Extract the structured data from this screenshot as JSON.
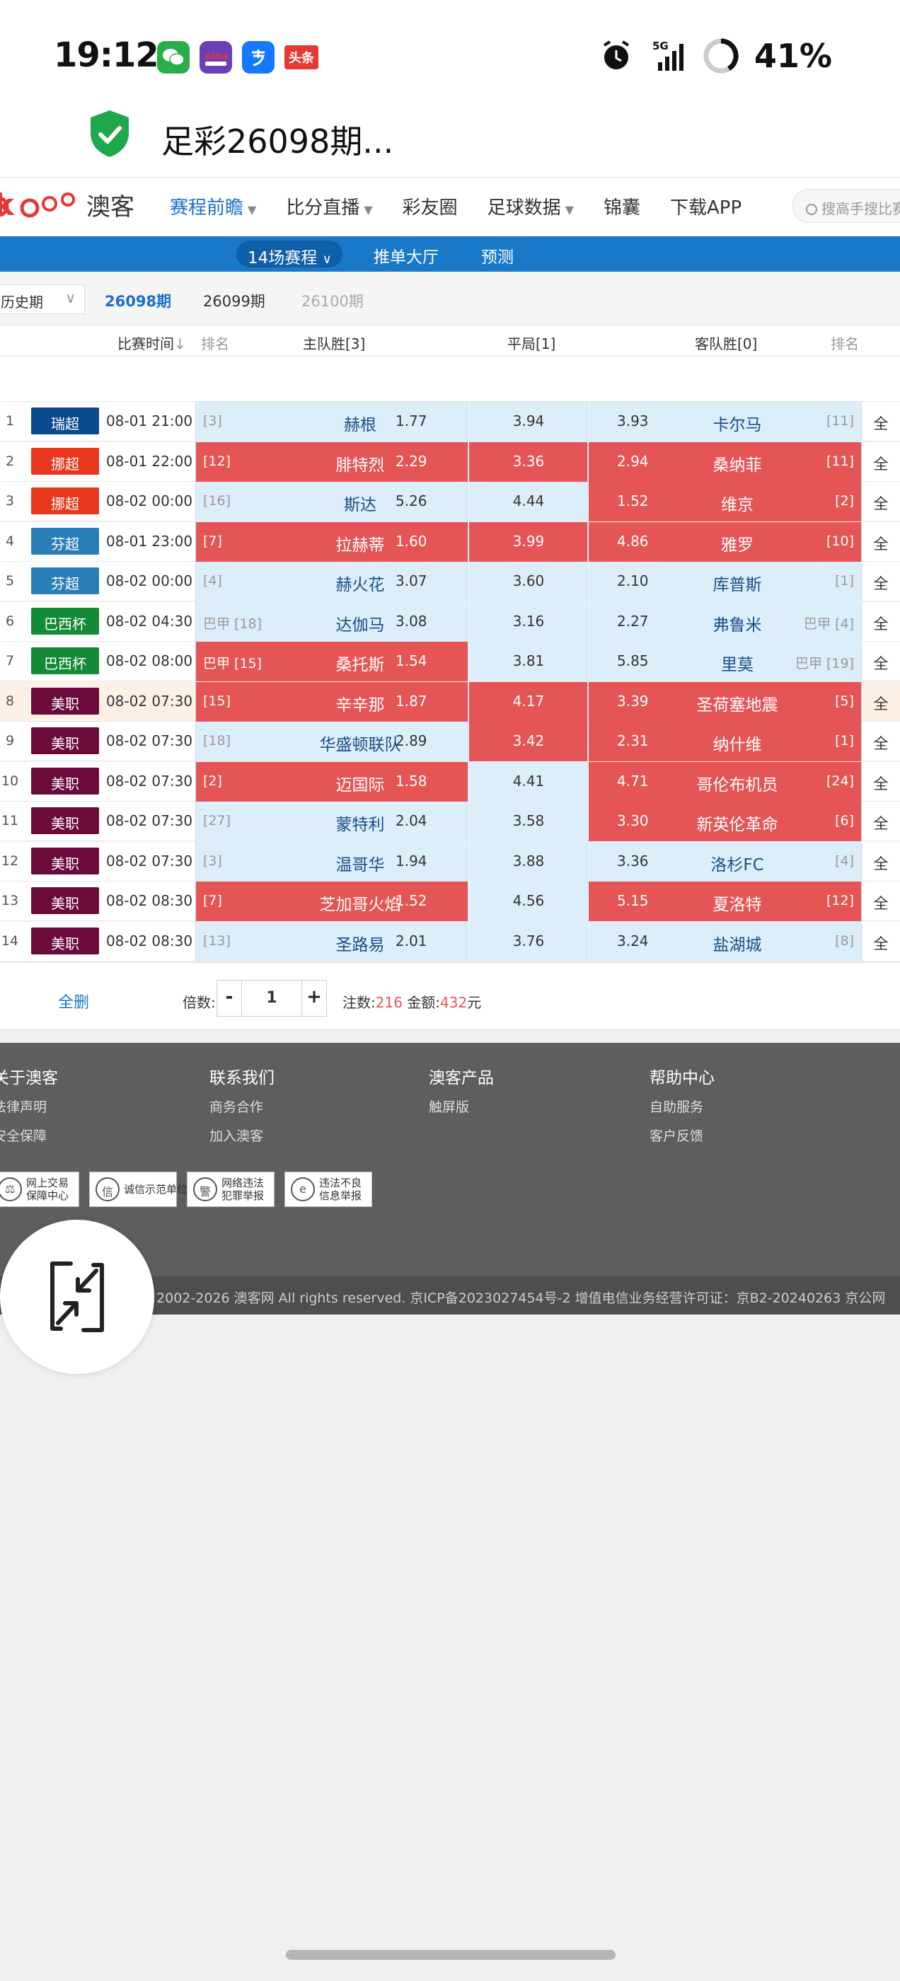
{
  "status_bar": {
    "time": "19:12",
    "battery": "41%",
    "network": "5G",
    "apps": [
      "wechat-icon",
      "sina-icon",
      "alipay-icon",
      "toutiao-icon"
    ],
    "toutiao_label": "头条"
  },
  "page": {
    "title": "足彩26098期..."
  },
  "nav": {
    "logo_text": "okooo",
    "logo_cn": "澳客",
    "items": [
      {
        "label": "赛程前瞻",
        "active": true,
        "caret": true
      },
      {
        "label": "比分直播",
        "active": false,
        "caret": true
      },
      {
        "label": "彩友圈",
        "active": false,
        "caret": false
      },
      {
        "label": "足球数据",
        "active": false,
        "caret": true
      },
      {
        "label": "锦囊",
        "active": false,
        "caret": false
      },
      {
        "label": "下载APP",
        "active": false,
        "caret": false
      }
    ],
    "search_placeholder": "搜高手搜比赛"
  },
  "subnav": {
    "selected": "14场赛程",
    "items": [
      "推单大厅",
      "预测"
    ]
  },
  "periods": {
    "history": "历史期",
    "current": "26098期",
    "next": "26099期",
    "future": "26100期"
  },
  "table": {
    "headers": {
      "time": "比赛时间",
      "home_rank": "排名",
      "home": "主队胜[3]",
      "draw": "平局[1]",
      "away": "客队胜[0]",
      "away_rank": "排名"
    },
    "all_label": "全",
    "rows": [
      {
        "no": "1",
        "league": "瑞超",
        "league_color": "#0b4a8f",
        "time": "08-01 21:00",
        "home_rank": "[3]",
        "home": "赫根",
        "home_odd": "1.77",
        "draw_odd": "3.94",
        "away_odd": "3.93",
        "away": "卡尔马",
        "away_rank": "[11]",
        "home_sel": false,
        "draw_sel": false,
        "away_sel": false,
        "hl": false
      },
      {
        "no": "2",
        "league": "挪超",
        "league_color": "#e8371d",
        "time": "08-01 22:00",
        "home_rank": "[12]",
        "home": "腓特烈",
        "home_odd": "2.29",
        "draw_odd": "3.36",
        "away_odd": "2.94",
        "away": "桑纳菲",
        "away_rank": "[11]",
        "home_sel": true,
        "draw_sel": true,
        "away_sel": true,
        "hl": false
      },
      {
        "no": "3",
        "league": "挪超",
        "league_color": "#e8371d",
        "time": "08-02 00:00",
        "home_rank": "[16]",
        "home": "斯达",
        "home_odd": "5.26",
        "draw_odd": "4.44",
        "away_odd": "1.52",
        "away": "维京",
        "away_rank": "[2]",
        "home_sel": false,
        "draw_sel": false,
        "away_sel": true,
        "hl": false
      },
      {
        "no": "4",
        "league": "芬超",
        "league_color": "#2a7fb8",
        "time": "08-01 23:00",
        "home_rank": "[7]",
        "home": "拉赫蒂",
        "home_odd": "1.60",
        "draw_odd": "3.99",
        "away_odd": "4.86",
        "away": "雅罗",
        "away_rank": "[10]",
        "home_sel": true,
        "draw_sel": true,
        "away_sel": true,
        "hl": false
      },
      {
        "no": "5",
        "league": "芬超",
        "league_color": "#2a7fb8",
        "time": "08-02 00:00",
        "home_rank": "[4]",
        "home": "赫火花",
        "home_odd": "3.07",
        "draw_odd": "3.60",
        "away_odd": "2.10",
        "away": "库普斯",
        "away_rank": "[1]",
        "home_sel": false,
        "draw_sel": false,
        "away_sel": false,
        "hl": false
      },
      {
        "no": "6",
        "league": "巴西杯",
        "league_color": "#138a36",
        "time": "08-02 04:30",
        "home_rank": "巴甲 [18]",
        "home": "达伽马",
        "home_odd": "3.08",
        "draw_odd": "3.16",
        "away_odd": "2.27",
        "away": "弗鲁米",
        "away_rank": "巴甲 [4]",
        "home_sel": false,
        "draw_sel": false,
        "away_sel": false,
        "hl": false
      },
      {
        "no": "7",
        "league": "巴西杯",
        "league_color": "#138a36",
        "time": "08-02 08:00",
        "home_rank": "巴甲 [15]",
        "home": "桑托斯",
        "home_odd": "1.54",
        "draw_odd": "3.81",
        "away_odd": "5.85",
        "away": "里莫",
        "away_rank": "巴甲 [19]",
        "home_sel": true,
        "draw_sel": false,
        "away_sel": false,
        "hl": false
      },
      {
        "no": "8",
        "league": "美职",
        "league_color": "#6b0a3a",
        "time": "08-02 07:30",
        "home_rank": "[15]",
        "home": "辛辛那",
        "home_odd": "1.87",
        "draw_odd": "4.17",
        "away_odd": "3.39",
        "away": "圣荷塞地震",
        "away_rank": "[5]",
        "home_sel": true,
        "draw_sel": true,
        "away_sel": true,
        "hl": true
      },
      {
        "no": "9",
        "league": "美职",
        "league_color": "#6b0a3a",
        "time": "08-02 07:30",
        "home_rank": "[18]",
        "home": "华盛顿联队",
        "home_odd": "2.89",
        "draw_odd": "3.42",
        "away_odd": "2.31",
        "away": "纳什维",
        "away_rank": "[1]",
        "home_sel": false,
        "draw_sel": true,
        "away_sel": true,
        "hl": false
      },
      {
        "no": "10",
        "league": "美职",
        "league_color": "#6b0a3a",
        "time": "08-02 07:30",
        "home_rank": "[2]",
        "home": "迈国际",
        "home_odd": "1.58",
        "draw_odd": "4.41",
        "away_odd": "4.71",
        "away": "哥伦布机员",
        "away_rank": "[24]",
        "home_sel": true,
        "draw_sel": false,
        "away_sel": true,
        "hl": false
      },
      {
        "no": "11",
        "league": "美职",
        "league_color": "#6b0a3a",
        "time": "08-02 07:30",
        "home_rank": "[27]",
        "home": "蒙特利",
        "home_odd": "2.04",
        "draw_odd": "3.58",
        "away_odd": "3.30",
        "away": "新英伦革命",
        "away_rank": "[6]",
        "home_sel": false,
        "draw_sel": false,
        "away_sel": true,
        "hl": false
      },
      {
        "no": "12",
        "league": "美职",
        "league_color": "#6b0a3a",
        "time": "08-02 07:30",
        "home_rank": "[3]",
        "home": "温哥华",
        "home_odd": "1.94",
        "draw_odd": "3.88",
        "away_odd": "3.36",
        "away": "洛杉FC",
        "away_rank": "[4]",
        "home_sel": false,
        "draw_sel": false,
        "away_sel": false,
        "hl": false
      },
      {
        "no": "13",
        "league": "美职",
        "league_color": "#6b0a3a",
        "time": "08-02 08:30",
        "home_rank": "[7]",
        "home": "芝加哥火焰",
        "home_odd": "1.52",
        "draw_odd": "4.56",
        "away_odd": "5.15",
        "away": "夏洛特",
        "away_rank": "[12]",
        "home_sel": true,
        "draw_sel": false,
        "away_sel": true,
        "hl": false
      },
      {
        "no": "14",
        "league": "美职",
        "league_color": "#6b0a3a",
        "time": "08-02 08:30",
        "home_rank": "[13]",
        "home": "圣路易",
        "home_odd": "2.01",
        "draw_odd": "3.76",
        "away_odd": "3.24",
        "away": "盐湖城",
        "away_rank": "[8]",
        "home_sel": false,
        "draw_sel": false,
        "away_sel": false,
        "hl": false
      }
    ]
  },
  "controls": {
    "clear_label": "全删",
    "multiplier_label": "倍数:",
    "minus": "-",
    "plus": "+",
    "multiplier": "1",
    "bets_label": "注数:",
    "bets": "216",
    "amount_label": "金额:",
    "amount": "432",
    "unit": "元"
  },
  "footer": {
    "columns": [
      {
        "title": "关于澳客",
        "links": [
          "法律声明",
          "安全保障"
        ]
      },
      {
        "title": "联系我们",
        "links": [
          "商务合作",
          "加入澳客"
        ]
      },
      {
        "title": "澳客产品",
        "links": [
          "触屏版"
        ]
      },
      {
        "title": "帮助中心",
        "links": [
          "自助服务",
          "客户反馈"
        ]
      }
    ],
    "badges": [
      {
        "icon": "scale-icon",
        "glyph": "⚖",
        "text": [
          "网上交易",
          "保障中心"
        ]
      },
      {
        "icon": "integrity-icon",
        "glyph": "信",
        "text": [
          "诚信示范单位"
        ]
      },
      {
        "icon": "police-icon",
        "glyph": "警",
        "text": [
          "网络违法",
          "犯罪举报"
        ]
      },
      {
        "icon": "report-icon",
        "glyph": "e",
        "text": [
          "违法不良",
          "信息举报"
        ]
      }
    ],
    "copyright": "© 2002-2026 澳客网  All rights reserved.   京ICP备2023027454号-2  增值电信业务经营许可证：京B2-20240263  京公网"
  }
}
